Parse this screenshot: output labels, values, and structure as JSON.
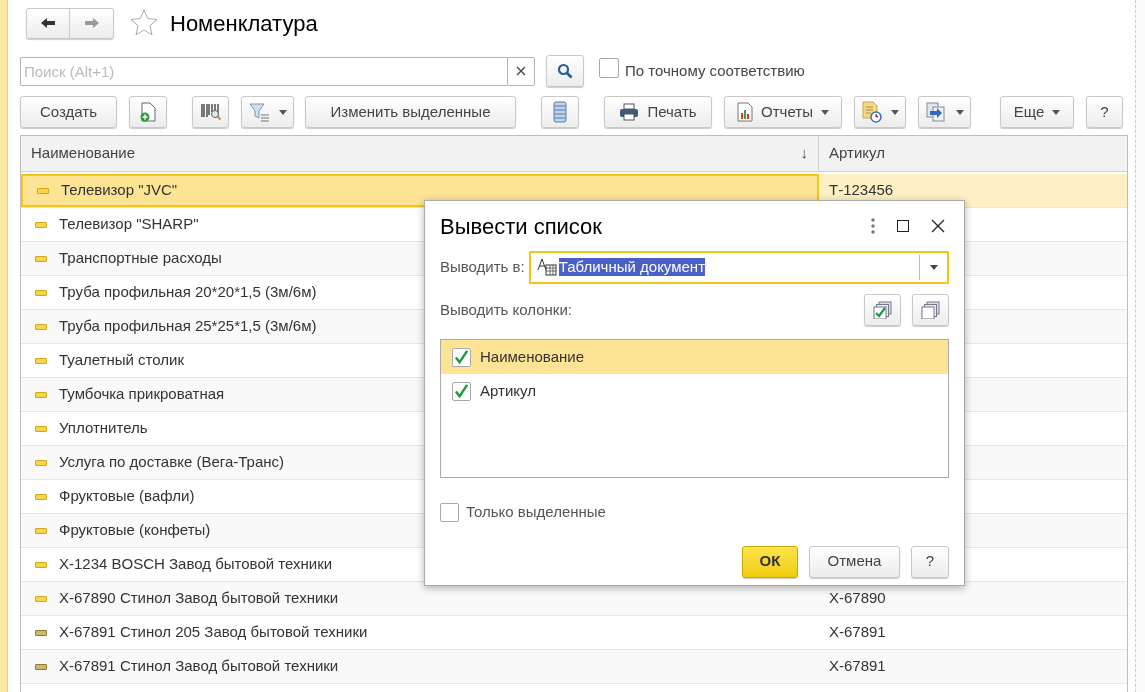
{
  "window": {
    "title": "Номенклатура",
    "favorite": false
  },
  "search": {
    "placeholder": "Поиск (Alt+1)"
  },
  "exact_match": {
    "label": "По точному соответствию",
    "checked": false
  },
  "toolbar": [
    {
      "label": "Создать",
      "dropdown": false
    },
    {
      "dropdown": false
    },
    {
      "dropdown": false
    },
    {
      "dropdown": true
    },
    {
      "label": "Изменить выделенные",
      "dropdown": false
    },
    {
      "dropdown": false
    },
    {
      "label": "Печать",
      "dropdown": false
    },
    {
      "label": "Отчеты",
      "dropdown": true
    },
    {
      "dropdown": true
    },
    {
      "dropdown": true
    },
    {
      "label": "Еще",
      "dropdown": true
    },
    {
      "label": "?",
      "dropdown": false
    }
  ],
  "table": {
    "columns": [
      {
        "label": "Наименование",
        "sort": "↓"
      },
      {
        "label": "Артикул"
      }
    ],
    "rows": [
      {
        "name": "Телевизор \"JVC\"",
        "article": "Т-123456",
        "selected": true,
        "dimmed": false
      },
      {
        "name": "Телевизор \"SHARP\"",
        "selected": false,
        "dimmed": false
      },
      {
        "name": "Транспортные расходы",
        "selected": false,
        "dimmed": false
      },
      {
        "name": "Труба профильная 20*20*1,5 (3м/6м)",
        "selected": false,
        "dimmed": false
      },
      {
        "name": "Труба профильная 25*25*1,5 (3м/6м)",
        "selected": false,
        "dimmed": false
      },
      {
        "name": "Туалетный столик",
        "selected": false,
        "dimmed": false
      },
      {
        "name": "Тумбочка прикроватная",
        "selected": false,
        "dimmed": false
      },
      {
        "name": "Уплотнитель",
        "selected": false,
        "dimmed": false
      },
      {
        "name": "Услуга по доставке (Вега-Транс)",
        "selected": false,
        "dimmed": false
      },
      {
        "name": "Фруктовые (вафли)",
        "selected": false,
        "dimmed": false
      },
      {
        "name": "Фруктовые (конфеты)",
        "selected": false,
        "dimmed": false
      },
      {
        "name": "Х-1234 BOSCH Завод бытовой техники",
        "selected": false,
        "dimmed": false
      },
      {
        "name": "Х-67890 Стинол Завод бытовой техники",
        "article": "Х-67890",
        "selected": false,
        "dimmed": false
      },
      {
        "name": "Х-67891 Стинол 205 Завод бытовой техники",
        "article": "Х-67891",
        "selected": false,
        "dimmed": true
      },
      {
        "name": "Х-67891 Стинол Завод бытовой техники",
        "article": "Х-67891",
        "selected": false,
        "dimmed": true
      }
    ]
  },
  "dialog": {
    "title": "Вывести список",
    "output_label": "Выводить в:",
    "output_value": "Табличный документ",
    "columns_label": "Выводить колонки:",
    "columns": [
      {
        "label": "Наименование",
        "checked": true,
        "selected": true
      },
      {
        "label": "Артикул",
        "checked": true,
        "selected": false
      }
    ],
    "only_selected": {
      "label": "Только выделенные",
      "checked": false
    },
    "buttons": [
      {
        "label": "ОК",
        "kind": "primary"
      },
      {
        "label": "Отмена",
        "kind": "default"
      },
      {
        "label": "?",
        "kind": "default"
      }
    ]
  }
}
